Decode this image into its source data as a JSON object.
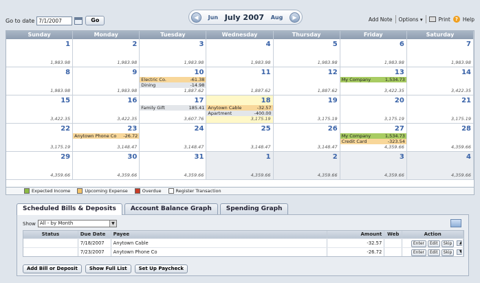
{
  "toolbar": {
    "goto_label": "Go to date",
    "goto_value": "7/1/2007",
    "go_label": "Go",
    "prev_month": "Jun",
    "current_month": "July 2007",
    "next_month": "Aug",
    "add_note": "Add Note",
    "options": "Options",
    "print": "Print",
    "help": "Help"
  },
  "calendar": {
    "weekdays": [
      "Sunday",
      "Monday",
      "Tuesday",
      "Wednesday",
      "Thursday",
      "Friday",
      "Saturday"
    ],
    "weeks": [
      [
        {
          "day": "1",
          "balance": "1,983.98"
        },
        {
          "day": "2",
          "balance": "1,983.98"
        },
        {
          "day": "3",
          "balance": "1,983.98"
        },
        {
          "day": "4",
          "balance": "1,983.98"
        },
        {
          "day": "5",
          "balance": "1,983.98"
        },
        {
          "day": "6",
          "balance": "1,983.98"
        },
        {
          "day": "7",
          "balance": "1,983.98"
        }
      ],
      [
        {
          "day": "8",
          "balance": "1,983.98"
        },
        {
          "day": "9",
          "balance": "1,983.98"
        },
        {
          "day": "10",
          "balance": "1,887.62",
          "events": [
            {
              "label": "Electric Co.",
              "amount": "-61.38",
              "kind": "expense"
            },
            {
              "label": "Dining",
              "amount": "-14.98",
              "kind": "register"
            }
          ]
        },
        {
          "day": "11",
          "balance": "1,887.62"
        },
        {
          "day": "12",
          "balance": "1,887.62"
        },
        {
          "day": "13",
          "balance": "3,422.35",
          "events": [
            {
              "label": "My Company",
              "amount": "1,534.73",
              "kind": "income"
            }
          ]
        },
        {
          "day": "14",
          "balance": "3,422.35"
        }
      ],
      [
        {
          "day": "15",
          "balance": "3,422.35"
        },
        {
          "day": "16",
          "balance": "3,422.35"
        },
        {
          "day": "17",
          "balance": "3,607.76",
          "events": [
            {
              "label": "Family Gift",
              "amount": "185.41",
              "kind": "register"
            }
          ]
        },
        {
          "day": "18",
          "balance": "3,175.19",
          "today": true,
          "events": [
            {
              "label": "Anytown Cable",
              "amount": "-32.57",
              "kind": "expense"
            },
            {
              "label": "Apartment",
              "amount": "-400.00",
              "kind": "register"
            }
          ]
        },
        {
          "day": "19",
          "balance": "3,175.19"
        },
        {
          "day": "20",
          "balance": "3,175.19"
        },
        {
          "day": "21",
          "balance": "3,175.19"
        }
      ],
      [
        {
          "day": "22",
          "balance": "3,175.19"
        },
        {
          "day": "23",
          "balance": "3,148.47",
          "events": [
            {
              "label": "Anytown Phone Co",
              "amount": "-26.72",
              "kind": "expense"
            }
          ]
        },
        {
          "day": "24",
          "balance": "3,148.47"
        },
        {
          "day": "25",
          "balance": "3,148.47"
        },
        {
          "day": "26",
          "balance": "3,148.47"
        },
        {
          "day": "27",
          "balance": "4,359.66",
          "events": [
            {
              "label": "My Company",
              "amount": "1,534.73",
              "kind": "income"
            },
            {
              "label": "Credit Card",
              "amount": "-323.54",
              "kind": "expense"
            }
          ]
        },
        {
          "day": "28",
          "balance": "4,359.66"
        }
      ],
      [
        {
          "day": "29",
          "balance": "4,359.66"
        },
        {
          "day": "30",
          "balance": "4,359.66"
        },
        {
          "day": "31",
          "balance": "4,359.66"
        },
        {
          "day": "1",
          "balance": "4,359.66",
          "other": true
        },
        {
          "day": "2",
          "balance": "4,359.66",
          "other": true
        },
        {
          "day": "3",
          "balance": "4,359.66",
          "other": true
        },
        {
          "day": "4",
          "balance": "4,359.66",
          "other": true
        }
      ]
    ]
  },
  "legend": [
    {
      "label": "Expected Income",
      "color": "#8dbb46"
    },
    {
      "label": "Upcoming Expense",
      "color": "#f4c46a"
    },
    {
      "label": "Overdue",
      "color": "#c83c28"
    },
    {
      "label": "Register Transaction",
      "color": "#ffffff"
    }
  ],
  "tabs": [
    "Scheduled Bills & Deposits",
    "Account Balance Graph",
    "Spending Graph"
  ],
  "bills": {
    "show_label": "Show",
    "show_value": "All - by Month",
    "columns": {
      "status": "Status",
      "due_date": "Due Date",
      "payee": "Payee",
      "amount": "Amount",
      "web": "Web",
      "action": "Action"
    },
    "rows": [
      {
        "status": "",
        "due_date": "7/18/2007",
        "payee": "Anytown Cable",
        "amount": "-32.57",
        "web": ""
      },
      {
        "status": "",
        "due_date": "7/23/2007",
        "payee": "Anytown Phone Co",
        "amount": "-26.72",
        "web": ""
      }
    ],
    "row_actions": [
      "Enter",
      "Edit",
      "Skip"
    ],
    "buttons": [
      "Add Bill or Deposit",
      "Show Full List",
      "Set Up Paycheck"
    ]
  },
  "colors": {
    "expense": "#f8d79a",
    "income": "#a8cc62",
    "register": "#e3e6ea",
    "today": "#fff8c8"
  }
}
